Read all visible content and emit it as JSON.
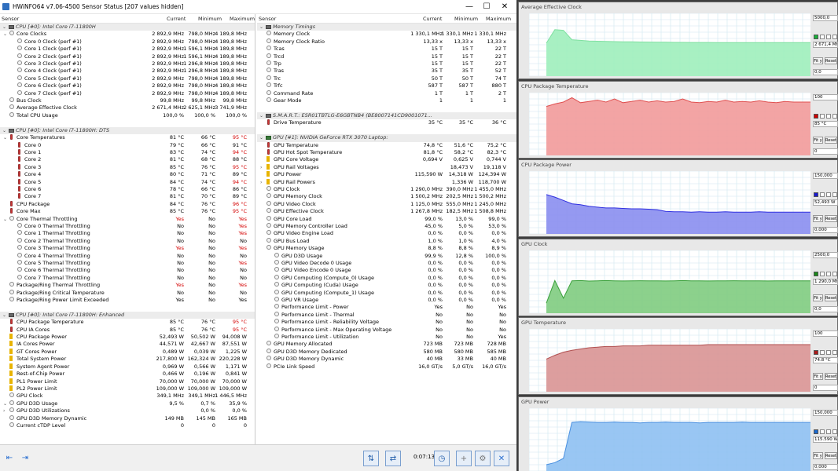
{
  "window": {
    "title": "HWiNFO64 v7.06-4500 Sensor Status [207 values hidden]",
    "minimize_glyph": "—",
    "maximize_glyph": "☐",
    "close_glyph": "✕"
  },
  "columns": {
    "sensor": "Sensor",
    "current": "Current",
    "minimum": "Minimum",
    "maximum": "Maximum"
  },
  "left_rows": [
    {
      "t": "g",
      "n": "CPU [#0]: Intel Core i7-11800H"
    },
    {
      "t": "r",
      "l": 1,
      "e": 1,
      "n": "Core Clocks",
      "c": "2 892,9 MHz",
      "mi": "798,0 MHz",
      "ma": "4 189,8 MHz"
    },
    {
      "t": "r",
      "l": 2,
      "n": "Core 0 Clock (perf #1)",
      "c": "2 892,9 MHz",
      "mi": "798,0 MHz",
      "ma": "4 189,8 MHz"
    },
    {
      "t": "r",
      "l": 2,
      "n": "Core 1 Clock (perf #1)",
      "c": "2 892,9 MHz",
      "mi": "1 596,1 MHz",
      "ma": "4 189,8 MHz"
    },
    {
      "t": "r",
      "l": 2,
      "n": "Core 2 Clock (perf #1)",
      "c": "2 892,9 MHz",
      "mi": "1 596,1 MHz",
      "ma": "4 189,8 MHz"
    },
    {
      "t": "r",
      "l": 2,
      "n": "Core 3 Clock (perf #1)",
      "c": "2 892,9 MHz",
      "mi": "1 296,8 MHz",
      "ma": "4 189,8 MHz"
    },
    {
      "t": "r",
      "l": 2,
      "n": "Core 4 Clock (perf #1)",
      "c": "2 892,9 MHz",
      "mi": "1 296,8 MHz",
      "ma": "4 189,8 MHz"
    },
    {
      "t": "r",
      "l": 2,
      "n": "Core 5 Clock (perf #1)",
      "c": "2 892,9 MHz",
      "mi": "798,0 MHz",
      "ma": "4 189,8 MHz"
    },
    {
      "t": "r",
      "l": 2,
      "n": "Core 6 Clock (perf #1)",
      "c": "2 892,9 MHz",
      "mi": "798,0 MHz",
      "ma": "4 189,8 MHz"
    },
    {
      "t": "r",
      "l": 2,
      "n": "Core 7 Clock (perf #1)",
      "c": "2 892,9 MHz",
      "mi": "798,0 MHz",
      "ma": "4 189,8 MHz"
    },
    {
      "t": "r",
      "l": 1,
      "n": "Bus Clock",
      "c": "99,8 MHz",
      "mi": "99,8 MHz",
      "ma": "99,8 MHz"
    },
    {
      "t": "r",
      "l": 1,
      "n": "Average Effective Clock",
      "c": "2 671,4 MHz",
      "mi": "2 625,1 MHz",
      "ma": "3 741,9 MHz"
    },
    {
      "t": "r",
      "l": 1,
      "n": "Total CPU Usage",
      "c": "100,0 %",
      "mi": "100,0 %",
      "ma": "100,0 %"
    },
    {
      "t": "s"
    },
    {
      "t": "g",
      "n": "CPU [#0]: Intel Core i7-11800H: DTS"
    },
    {
      "t": "r",
      "l": 1,
      "e": 1,
      "n": "Core Temperatures",
      "c": "81 °C",
      "mi": "66 °C",
      "ma": "95 °C",
      "mr": 1,
      "k": "therm"
    },
    {
      "t": "r",
      "l": 2,
      "n": "Core 0",
      "c": "79 °C",
      "mi": "66 °C",
      "ma": "91 °C",
      "k": "therm"
    },
    {
      "t": "r",
      "l": 2,
      "n": "Core 1",
      "c": "83 °C",
      "mi": "74 °C",
      "ma": "94 °C",
      "mr": 1,
      "k": "therm"
    },
    {
      "t": "r",
      "l": 2,
      "n": "Core 2",
      "c": "81 °C",
      "mi": "68 °C",
      "ma": "88 °C",
      "k": "therm"
    },
    {
      "t": "r",
      "l": 2,
      "n": "Core 3",
      "c": "85 °C",
      "mi": "76 °C",
      "ma": "95 °C",
      "mr": 1,
      "k": "therm"
    },
    {
      "t": "r",
      "l": 2,
      "n": "Core 4",
      "c": "80 °C",
      "mi": "71 °C",
      "ma": "89 °C",
      "k": "therm"
    },
    {
      "t": "r",
      "l": 2,
      "n": "Core 5",
      "c": "84 °C",
      "mi": "74 °C",
      "ma": "94 °C",
      "mr": 1,
      "k": "therm"
    },
    {
      "t": "r",
      "l": 2,
      "n": "Core 6",
      "c": "78 °C",
      "mi": "66 °C",
      "ma": "86 °C",
      "k": "therm"
    },
    {
      "t": "r",
      "l": 2,
      "n": "Core 7",
      "c": "81 °C",
      "mi": "70 °C",
      "ma": "89 °C",
      "k": "therm"
    },
    {
      "t": "r",
      "l": 1,
      "n": "CPU Package",
      "c": "84 °C",
      "mi": "76 °C",
      "ma": "96 °C",
      "mr": 1,
      "k": "therm"
    },
    {
      "t": "r",
      "l": 1,
      "n": "Core Max",
      "c": "85 °C",
      "mi": "76 °C",
      "ma": "95 °C",
      "mr": 1,
      "k": "therm"
    },
    {
      "t": "r",
      "l": 1,
      "e": 1,
      "n": "Core Thermal Throttling",
      "c": "Yes",
      "mi": "No",
      "ma": "Yes",
      "cr": 1,
      "mr": 1
    },
    {
      "t": "r",
      "l": 2,
      "n": "Core 0 Thermal Throttling",
      "c": "No",
      "mi": "No",
      "ma": "Yes",
      "mr": 1
    },
    {
      "t": "r",
      "l": 2,
      "n": "Core 1 Thermal Throttling",
      "c": "No",
      "mi": "No",
      "ma": "Yes",
      "mr": 1
    },
    {
      "t": "r",
      "l": 2,
      "n": "Core 2 Thermal Throttling",
      "c": "No",
      "mi": "No",
      "ma": "No"
    },
    {
      "t": "r",
      "l": 2,
      "n": "Core 3 Thermal Throttling",
      "c": "Yes",
      "mi": "No",
      "ma": "Yes",
      "cr": 1,
      "mr": 1
    },
    {
      "t": "r",
      "l": 2,
      "n": "Core 4 Thermal Throttling",
      "c": "No",
      "mi": "No",
      "ma": "No"
    },
    {
      "t": "r",
      "l": 2,
      "n": "Core 5 Thermal Throttling",
      "c": "No",
      "mi": "No",
      "ma": "Yes",
      "mr": 1
    },
    {
      "t": "r",
      "l": 2,
      "n": "Core 6 Thermal Throttling",
      "c": "No",
      "mi": "No",
      "ma": "No"
    },
    {
      "t": "r",
      "l": 2,
      "n": "Core 7 Thermal Throttling",
      "c": "No",
      "mi": "No",
      "ma": "No"
    },
    {
      "t": "r",
      "l": 1,
      "n": "Package/Ring Thermal Throttling",
      "c": "Yes",
      "mi": "No",
      "ma": "Yes",
      "cr": 1,
      "mr": 1
    },
    {
      "t": "r",
      "l": 1,
      "n": "Package/Ring Critical Temperature",
      "c": "No",
      "mi": "No",
      "ma": "No"
    },
    {
      "t": "r",
      "l": 1,
      "n": "Package/Ring Power Limit Exceeded",
      "c": "Yes",
      "mi": "No",
      "ma": "Yes"
    },
    {
      "t": "s"
    },
    {
      "t": "g",
      "n": "CPU [#0]: Intel Core i7-11800H: Enhanced"
    },
    {
      "t": "r",
      "l": 1,
      "n": "CPU Package Temperature",
      "c": "85 °C",
      "mi": "76 °C",
      "ma": "95 °C",
      "mr": 1,
      "k": "therm"
    },
    {
      "t": "r",
      "l": 1,
      "n": "CPU IA Cores",
      "c": "85 °C",
      "mi": "76 °C",
      "ma": "95 °C",
      "mr": 1,
      "k": "therm"
    },
    {
      "t": "r",
      "l": 1,
      "n": "CPU Package Power",
      "c": "52,493 W",
      "mi": "50,502 W",
      "ma": "94,008 W",
      "k": "bolt"
    },
    {
      "t": "r",
      "l": 1,
      "n": "IA Cores Power",
      "c": "44,571 W",
      "mi": "42,667 W",
      "ma": "87,551 W",
      "k": "bolt"
    },
    {
      "t": "r",
      "l": 1,
      "n": "GT Cores Power",
      "c": "0,489 W",
      "mi": "0,039 W",
      "ma": "1,225 W",
      "k": "bolt"
    },
    {
      "t": "r",
      "l": 1,
      "n": "Total System Power",
      "c": "217,800 W",
      "mi": "162,324 W",
      "ma": "220,228 W",
      "k": "bolt"
    },
    {
      "t": "r",
      "l": 1,
      "n": "System Agent Power",
      "c": "0,969 W",
      "mi": "0,566 W",
      "ma": "1,171 W",
      "k": "bolt"
    },
    {
      "t": "r",
      "l": 1,
      "n": "Rest-of-Chip Power",
      "c": "0,466 W",
      "mi": "0,196 W",
      "ma": "0,841 W",
      "k": "bolt"
    },
    {
      "t": "r",
      "l": 1,
      "n": "PL1 Power Limit",
      "c": "70,000 W",
      "mi": "70,000 W",
      "ma": "70,000 W",
      "k": "bolt"
    },
    {
      "t": "r",
      "l": 1,
      "n": "PL2 Power Limit",
      "c": "109,000 W",
      "mi": "109,000 W",
      "ma": "109,000 W",
      "k": "bolt"
    },
    {
      "t": "r",
      "l": 1,
      "n": "GPU Clock",
      "c": "349,1 MHz",
      "mi": "349,1 MHz",
      "ma": "1 446,5 MHz"
    },
    {
      "t": "r",
      "l": 1,
      "e": 1,
      "n": "GPU D3D Usage",
      "c": "9,5 %",
      "mi": "0,7 %",
      "ma": "35,9 %"
    },
    {
      "t": "r",
      "l": 1,
      "e": 2,
      "n": "GPU D3D Utilizations",
      "c": "",
      "mi": "0,0 %",
      "ma": "0,0 %"
    },
    {
      "t": "r",
      "l": 1,
      "n": "GPU D3D Memory Dynamic",
      "c": "149 MB",
      "mi": "145 MB",
      "ma": "165 MB"
    },
    {
      "t": "r",
      "l": 1,
      "n": "Current cTDP Level",
      "c": "0",
      "mi": "0",
      "ma": "0"
    }
  ],
  "right_rows": [
    {
      "t": "g",
      "n": "Memory Timings"
    },
    {
      "t": "r",
      "l": 1,
      "n": "Memory Clock",
      "c": "1 330,1 MHz",
      "mi": "1 330,1 MHz",
      "ma": "1 330,1 MHz"
    },
    {
      "t": "r",
      "l": 1,
      "n": "Memory Clock Ratio",
      "c": "13,33 x",
      "mi": "13,33 x",
      "ma": "13,33 x"
    },
    {
      "t": "r",
      "l": 1,
      "n": "Tcas",
      "c": "15 T",
      "mi": "15 T",
      "ma": "22 T"
    },
    {
      "t": "r",
      "l": 1,
      "n": "Trcd",
      "c": "15 T",
      "mi": "15 T",
      "ma": "22 T"
    },
    {
      "t": "r",
      "l": 1,
      "n": "Trp",
      "c": "15 T",
      "mi": "15 T",
      "ma": "22 T"
    },
    {
      "t": "r",
      "l": 1,
      "n": "Tras",
      "c": "35 T",
      "mi": "35 T",
      "ma": "52 T"
    },
    {
      "t": "r",
      "l": 1,
      "n": "Trc",
      "c": "50 T",
      "mi": "50 T",
      "ma": "74 T"
    },
    {
      "t": "r",
      "l": 1,
      "n": "Trfc",
      "c": "587 T",
      "mi": "587 T",
      "ma": "880 T"
    },
    {
      "t": "r",
      "l": 1,
      "n": "Command Rate",
      "c": "1 T",
      "mi": "1 T",
      "ma": "2 T"
    },
    {
      "t": "r",
      "l": 1,
      "n": "Gear Mode",
      "c": "1",
      "mi": "1",
      "ma": "1"
    },
    {
      "t": "s"
    },
    {
      "t": "g",
      "n": "S.M.A.R.T.: ESR01TBTLG-E6GBTNB4 (BE8007141CD9001071..."
    },
    {
      "t": "r",
      "l": 1,
      "n": "Drive Temperature",
      "c": "35 °C",
      "mi": "35 °C",
      "ma": "36 °C",
      "k": "therm"
    },
    {
      "t": "s"
    },
    {
      "t": "g",
      "n": "GPU [#1]: NVIDIA GeForce RTX 3070 Laptop:",
      "k": "gpu"
    },
    {
      "t": "r",
      "l": 1,
      "n": "GPU Temperature",
      "c": "74,8 °C",
      "mi": "51,6 °C",
      "ma": "75,2 °C",
      "k": "therm"
    },
    {
      "t": "r",
      "l": 1,
      "n": "GPU Hot Spot Temperature",
      "c": "81,8 °C",
      "mi": "58,2 °C",
      "ma": "82,3 °C",
      "k": "therm"
    },
    {
      "t": "r",
      "l": 1,
      "n": "GPU Core Voltage",
      "c": "0,694 V",
      "mi": "0,625 V",
      "ma": "0,744 V",
      "k": "bolt"
    },
    {
      "t": "r",
      "l": 1,
      "e": 2,
      "n": "GPU Rail Voltages",
      "c": "",
      "mi": "18,473 V",
      "ma": "19,118 V",
      "k": "bolt"
    },
    {
      "t": "r",
      "l": 1,
      "n": "GPU Power",
      "c": "115,590 W",
      "mi": "14,318 W",
      "ma": "124,394 W",
      "k": "bolt"
    },
    {
      "t": "r",
      "l": 1,
      "e": 2,
      "n": "GPU Rail Powers",
      "c": "",
      "mi": "1,336 W",
      "ma": "118,700 W",
      "k": "bolt"
    },
    {
      "t": "r",
      "l": 1,
      "n": "GPU Clock",
      "c": "1 290,0 MHz",
      "mi": "390,0 MHz",
      "ma": "1 455,0 MHz"
    },
    {
      "t": "r",
      "l": 1,
      "n": "GPU Memory Clock",
      "c": "1 500,2 MHz",
      "mi": "202,5 MHz",
      "ma": "1 500,2 MHz"
    },
    {
      "t": "r",
      "l": 1,
      "n": "GPU Video Clock",
      "c": "1 125,0 MHz",
      "mi": "555,0 MHz",
      "ma": "1 245,0 MHz"
    },
    {
      "t": "r",
      "l": 1,
      "n": "GPU Effective Clock",
      "c": "1 267,8 MHz",
      "mi": "182,5 MHz",
      "ma": "1 508,8 MHz"
    },
    {
      "t": "r",
      "l": 1,
      "n": "GPU Core Load",
      "c": "99,0 %",
      "mi": "13,0 %",
      "ma": "99,0 %"
    },
    {
      "t": "r",
      "l": 1,
      "n": "GPU Memory Controller Load",
      "c": "45,0 %",
      "mi": "5,0 %",
      "ma": "53,0 %"
    },
    {
      "t": "r",
      "l": 1,
      "n": "GPU Video Engine Load",
      "c": "0,0 %",
      "mi": "0,0 %",
      "ma": "0,0 %"
    },
    {
      "t": "r",
      "l": 1,
      "n": "GPU Bus Load",
      "c": "1,0 %",
      "mi": "1,0 %",
      "ma": "4,0 %"
    },
    {
      "t": "r",
      "l": 1,
      "n": "GPU Memory Usage",
      "c": "8,8 %",
      "mi": "8,8 %",
      "ma": "8,9 %"
    },
    {
      "t": "r",
      "l": 2,
      "n": "GPU D3D Usage",
      "c": "99,9 %",
      "mi": "12,8 %",
      "ma": "100,0 %"
    },
    {
      "t": "r",
      "l": 2,
      "n": "GPU Video Decode 0 Usage",
      "c": "0,0 %",
      "mi": "0,0 %",
      "ma": "0,0 %"
    },
    {
      "t": "r",
      "l": 2,
      "n": "GPU Video Encode 0 Usage",
      "c": "0,0 %",
      "mi": "0,0 %",
      "ma": "0,0 %"
    },
    {
      "t": "r",
      "l": 2,
      "n": "GPU Computing (Compute_0) Usage",
      "c": "0,0 %",
      "mi": "0,0 %",
      "ma": "0,0 %"
    },
    {
      "t": "r",
      "l": 2,
      "n": "GPU Computing (Cuda) Usage",
      "c": "0,0 %",
      "mi": "0,0 %",
      "ma": "0,0 %"
    },
    {
      "t": "r",
      "l": 2,
      "n": "GPU Computing (Compute_1) Usage",
      "c": "0,0 %",
      "mi": "0,0 %",
      "ma": "0,0 %"
    },
    {
      "t": "r",
      "l": 2,
      "n": "GPU VR Usage",
      "c": "0,0 %",
      "mi": "0,0 %",
      "ma": "0,0 %"
    },
    {
      "t": "r",
      "l": 2,
      "n": "Performance Limit - Power",
      "c": "Yes",
      "mi": "No",
      "ma": "Yes"
    },
    {
      "t": "r",
      "l": 2,
      "n": "Performance Limit - Thermal",
      "c": "No",
      "mi": "No",
      "ma": "No"
    },
    {
      "t": "r",
      "l": 2,
      "n": "Performance Limit - Reliability Voltage",
      "c": "No",
      "mi": "No",
      "ma": "No"
    },
    {
      "t": "r",
      "l": 2,
      "n": "Performance Limit - Max Operating Voltage",
      "c": "No",
      "mi": "No",
      "ma": "No"
    },
    {
      "t": "r",
      "l": 2,
      "n": "Performance Limit - Utilization",
      "c": "No",
      "mi": "No",
      "ma": "Yes"
    },
    {
      "t": "r",
      "l": 1,
      "n": "GPU Memory Allocated",
      "c": "723 MB",
      "mi": "723 MB",
      "ma": "728 MB"
    },
    {
      "t": "r",
      "l": 1,
      "n": "GPU D3D Memory Dedicated",
      "c": "580 MB",
      "mi": "580 MB",
      "ma": "585 MB"
    },
    {
      "t": "r",
      "l": 1,
      "n": "GPU D3D Memory Dynamic",
      "c": "40 MB",
      "mi": "33 MB",
      "ma": "40 MB"
    },
    {
      "t": "r",
      "l": 1,
      "n": "PCIe Link Speed",
      "c": "16,0 GT/s",
      "mi": "5,0 GT/s",
      "ma": "16,0 GT/s"
    }
  ],
  "bottom": {
    "timer": "0:07:13",
    "nav_left_icon": "arrow-left-icon",
    "nav_right_icon": "arrow-right-icon",
    "network_icon": "network-icon",
    "sensors_icon": "sensors-icon",
    "clock_icon": "clock-icon",
    "add_icon": "add-icon",
    "settings_icon": "settings-icon",
    "close_icon": "close-icon"
  },
  "graph_labels": {
    "fit": "Fit y",
    "reset": "Reset"
  },
  "graphs": [
    {
      "title": "Average Effective Clock",
      "max": "5000,0",
      "cur": "2 671,4 MHz",
      "min": "0,0",
      "color": "#7fe0a0",
      "fill": "#9feebb",
      "swatch": "#19b23a",
      "ymax": 5000,
      "series": [
        2625,
        3700,
        3650,
        2900,
        2850,
        2800,
        2780,
        2760,
        2750,
        2740,
        2730,
        2720,
        2710,
        2700,
        2700,
        2690,
        2690,
        2680,
        2680,
        2680,
        2675,
        2675,
        2672,
        2672,
        2671,
        2671,
        2671,
        2671,
        2671,
        2671,
        2671,
        2671
      ]
    },
    {
      "title": "CPU Package Temperature",
      "max": "100",
      "cur": "85 °C",
      "min": "0",
      "color": "#e05050",
      "fill": "#f29a9a",
      "swatch": "#d00000",
      "ymax": 100,
      "series": [
        78,
        82,
        85,
        92,
        84,
        86,
        88,
        85,
        90,
        84,
        86,
        88,
        85,
        87,
        85,
        86,
        90,
        85,
        84,
        86,
        85,
        88,
        85,
        86,
        85,
        87,
        85,
        84,
        86,
        85,
        85,
        85
      ]
    },
    {
      "title": "CPU Package Power",
      "max": "150,000",
      "cur": "52,493 W",
      "min": "0,000",
      "color": "#3030e0",
      "fill": "#8a8ef0",
      "swatch": "#1a1ad0",
      "ymax": 150,
      "series": [
        94,
        88,
        80,
        72,
        70,
        66,
        64,
        62,
        62,
        61,
        60,
        60,
        59,
        58,
        54,
        53,
        53,
        52,
        53,
        52,
        52,
        53,
        52,
        52,
        52,
        53,
        52,
        52,
        52,
        52,
        52,
        52
      ]
    },
    {
      "title": "GPU Clock",
      "max": "2500,0",
      "cur": "1 290,0 MHz",
      "min": "0,0",
      "color": "#3aa03a",
      "fill": "#7fcc7f",
      "swatch": "#1a8a1a",
      "ymax": 2500,
      "series": [
        400,
        1300,
        600,
        1290,
        1300,
        1280,
        1290,
        1300,
        1290,
        1285,
        1290,
        1295,
        1290,
        1290,
        1285,
        1290,
        1300,
        1290,
        1290,
        1285,
        1290,
        1290,
        1295,
        1290,
        1290,
        1290,
        1285,
        1290,
        1290,
        1290,
        1290,
        1290
      ]
    },
    {
      "title": "GPU Temperature",
      "max": "100",
      "cur": "74.8 °C",
      "min": "0",
      "color": "#b05050",
      "fill": "#d99494",
      "swatch": "#aa1a1a",
      "ymax": 100,
      "series": [
        52,
        58,
        63,
        66,
        68,
        70,
        71,
        72,
        72,
        73,
        73,
        73,
        74,
        74,
        74,
        74,
        74,
        74,
        74,
        75,
        75,
        75,
        75,
        75,
        75,
        75,
        75,
        75,
        75,
        75,
        75,
        75
      ]
    },
    {
      "title": "GPU Power",
      "max": "150,000",
      "cur": "115.590 W",
      "min": "0,000",
      "color": "#4a90e0",
      "fill": "#8ec0f2",
      "swatch": "#1a6ad0",
      "ymax": 150,
      "series": [
        15,
        20,
        30,
        116,
        118,
        117,
        116,
        116,
        117,
        116,
        116,
        115,
        116,
        116,
        117,
        116,
        116,
        116,
        115,
        116,
        116,
        116,
        116,
        117,
        116,
        116,
        116,
        116,
        116,
        116,
        116,
        116
      ]
    }
  ]
}
